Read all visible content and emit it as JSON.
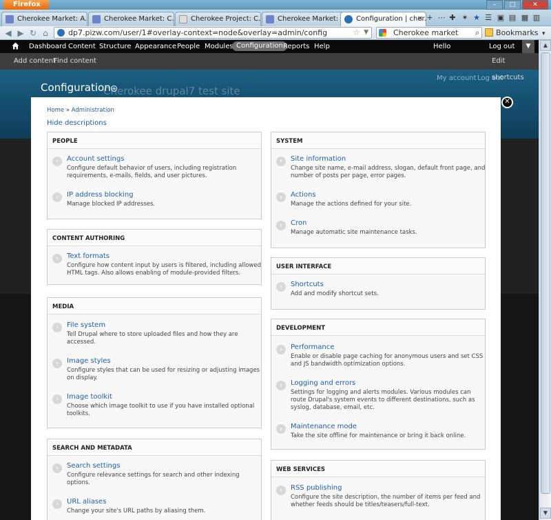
{
  "browser": {
    "app_button": "Firefox",
    "tabs": [
      {
        "title": "Cherokee Market: A..."
      },
      {
        "title": "Cherokee Market: C..."
      },
      {
        "title": "Cherokee Project: C..."
      },
      {
        "title": "Cherokee Market: C..."
      },
      {
        "title": "Configuration | cher..."
      }
    ],
    "url": "dp7.pizw.com/user/1#overlay-context=node&overlay=admin/config",
    "search": "Cherokee market",
    "bookmarks_label": "Bookmarks"
  },
  "toolbar": {
    "items": [
      "Dashboard",
      "Content",
      "Structure",
      "Appearance",
      "People",
      "Modules",
      "Configuration",
      "Reports",
      "Help"
    ],
    "hello": "Hello",
    "logout": "Log out",
    "shortcuts": [
      "Add content",
      "Find content"
    ],
    "edit_shortcuts": "Edit shortcuts"
  },
  "page": {
    "title": "Configuration",
    "site_name": "Cherokee drupal7 test site",
    "my_account": "My account",
    "log_out": "Log out"
  },
  "overlay": {
    "breadcrumb": [
      "Home",
      "Administration"
    ],
    "breadcrumb_sep": "»",
    "hide_descriptions": "Hide descriptions",
    "left_panels": [
      {
        "title": "PEOPLE",
        "items": [
          {
            "link": "Account settings",
            "desc": "Configure default behavior of users, including registration requirements, e-mails, fields, and user pictures."
          },
          {
            "link": "IP address blocking",
            "desc": "Manage blocked IP addresses."
          }
        ]
      },
      {
        "title": "CONTENT AUTHORING",
        "items": [
          {
            "link": "Text formats",
            "desc": "Configure how content input by users is filtered, including allowed HTML tags. Also allows enabling of module-provided filters."
          }
        ]
      },
      {
        "title": "MEDIA",
        "items": [
          {
            "link": "File system",
            "desc": "Tell Drupal where to store uploaded files and how they are accessed."
          },
          {
            "link": "Image styles",
            "desc": "Configure styles that can be used for resizing or adjusting images on display."
          },
          {
            "link": "Image toolkit",
            "desc": "Choose which image toolkit to use if you have installed optional toolkits."
          }
        ]
      },
      {
        "title": "SEARCH AND METADATA",
        "items": [
          {
            "link": "Search settings",
            "desc": "Configure relevance settings for search and other indexing options."
          },
          {
            "link": "URL aliases",
            "desc": "Change your site's URL paths by aliasing them."
          }
        ]
      }
    ],
    "right_panels": [
      {
        "title": "SYSTEM",
        "items": [
          {
            "link": "Site information",
            "desc": "Change site name, e-mail address, slogan, default front page, and number of posts per page, error pages."
          },
          {
            "link": "Actions",
            "desc": "Manage the actions defined for your site."
          },
          {
            "link": "Cron",
            "desc": "Manage automatic site maintenance tasks."
          }
        ]
      },
      {
        "title": "USER INTERFACE",
        "items": [
          {
            "link": "Shortcuts",
            "desc": "Add and modify shortcut sets."
          }
        ]
      },
      {
        "title": "DEVELOPMENT",
        "items": [
          {
            "link": "Performance",
            "desc": "Enable or disable page caching for anonymous users and set CSS and JS bandwidth optimization options."
          },
          {
            "link": "Logging and errors",
            "desc": "Settings for logging and alerts modules. Various modules can route Drupal's system events to different destinations, such as syslog, database, email, etc."
          },
          {
            "link": "Maintenance mode",
            "desc": "Take the site offline for maintenance or bring it back online."
          }
        ]
      },
      {
        "title": "WEB SERVICES",
        "items": [
          {
            "link": "RSS publishing",
            "desc": "Configure the site description, the number of items per feed and whether feeds should be titles/teasers/full-text."
          }
        ]
      }
    ]
  }
}
